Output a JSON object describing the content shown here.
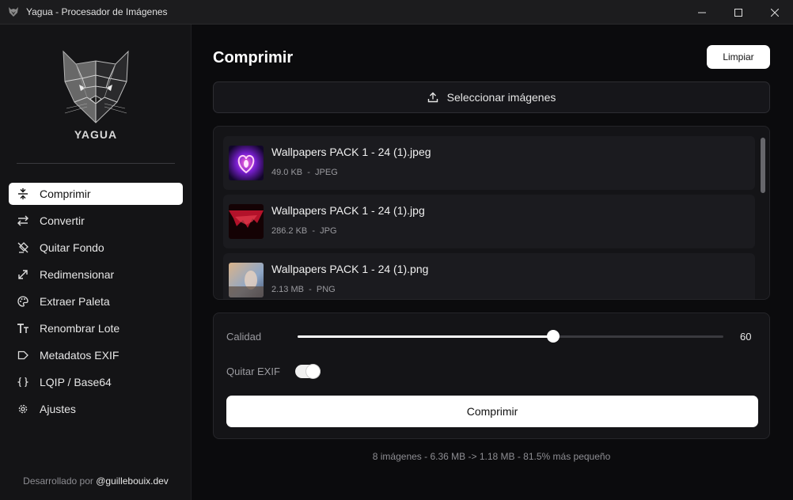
{
  "window": {
    "title": "Yagua - Procesador de Imágenes"
  },
  "sidebar": {
    "brand": "YAGUA",
    "items": [
      {
        "label": "Comprimir",
        "icon": "compress-icon",
        "active": true
      },
      {
        "label": "Convertir",
        "icon": "swap-arrows-icon",
        "active": false
      },
      {
        "label": "Quitar Fondo",
        "icon": "background-remove-icon",
        "active": false
      },
      {
        "label": "Redimensionar",
        "icon": "resize-arrow-icon",
        "active": false
      },
      {
        "label": "Extraer Paleta",
        "icon": "palette-icon",
        "active": false
      },
      {
        "label": "Renombrar Lote",
        "icon": "text-rename-icon",
        "active": false
      },
      {
        "label": "Metadatos EXIF",
        "icon": "tag-icon",
        "active": false
      },
      {
        "label": "LQIP / Base64",
        "icon": "braces-icon",
        "active": false
      },
      {
        "label": "Ajustes",
        "icon": "gear-icon",
        "active": false
      }
    ],
    "credit_prefix": "Desarrollado por",
    "credit_handle": "@guillebouix.dev"
  },
  "main": {
    "title": "Comprimir",
    "clear_label": "Limpiar",
    "select_label": "Seleccionar imágenes",
    "files": [
      {
        "name": "Wallpapers PACK 1 - 24 (1).jpeg",
        "meta": "49.0 KB  -  JPEG"
      },
      {
        "name": "Wallpapers PACK 1 - 24 (1).jpg",
        "meta": "286.2 KB  -  JPG"
      },
      {
        "name": "Wallpapers PACK 1 - 24 (1).png",
        "meta": "2.13 MB  -  PNG"
      }
    ],
    "quality_label": "Calidad",
    "quality_value": "60",
    "quality_fraction": 0.6,
    "exif_label": "Quitar EXIF",
    "exif_enabled": true,
    "compress_label": "Comprimir",
    "summary": "8 imágenes - 6.36 MB -> 1.18 MB - 81.5% más pequeño"
  },
  "colors": {
    "background": "#0b0b0d",
    "sidebar": "#141416",
    "panel": "#141417",
    "accent": "#ffffff"
  }
}
